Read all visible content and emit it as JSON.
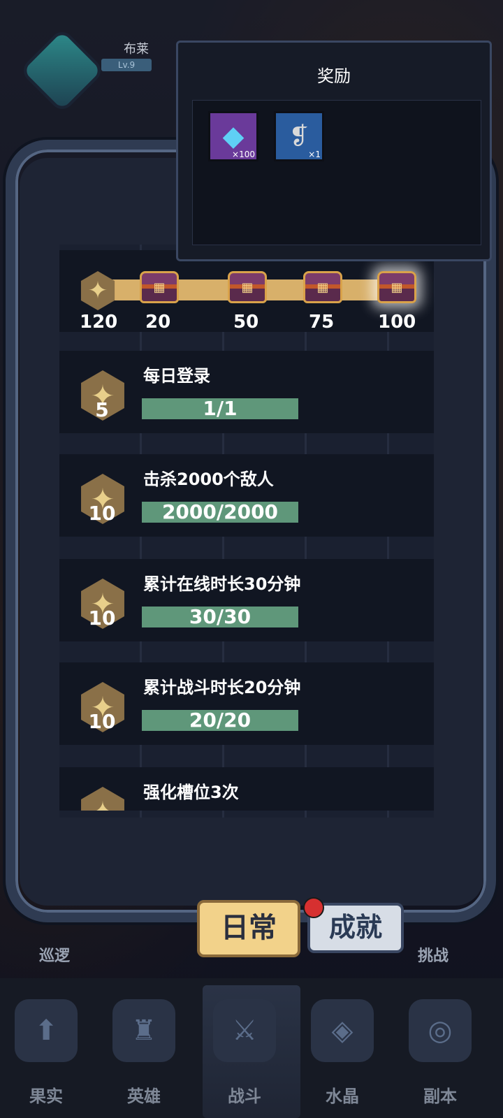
{
  "player": {
    "name": "布莱",
    "level": "Lv.9"
  },
  "panel": {
    "tab_title": "日常"
  },
  "reward_popup": {
    "title": "奖励",
    "items": [
      {
        "icon": "diamond-icon",
        "qty": "×100"
      },
      {
        "icon": "scroll-icon",
        "qty": "×1"
      }
    ]
  },
  "progress": {
    "current_points": "120",
    "milestones": [
      "20",
      "50",
      "75",
      "100"
    ]
  },
  "tasks": [
    {
      "name": "每日登录",
      "points": "5",
      "progress": "1/1"
    },
    {
      "name": "击杀2000个敌人",
      "points": "10",
      "progress": "2000/2000"
    },
    {
      "name": "累计在线时长30分钟",
      "points": "10",
      "progress": "30/30"
    },
    {
      "name": "累计战斗时长20分钟",
      "points": "10",
      "progress": "20/20"
    },
    {
      "name": "强化槽位3次"
    }
  ],
  "tabs": {
    "daily": "日常",
    "achievement": "成就"
  },
  "side": {
    "left": "巡逻",
    "right": "挑战"
  },
  "nav": {
    "items": [
      {
        "label": "果实",
        "icon": "fruit-icon"
      },
      {
        "label": "英雄",
        "icon": "hero-icon"
      },
      {
        "label": "战斗",
        "icon": "battle-icon"
      },
      {
        "label": "水晶",
        "icon": "crystal-icon"
      },
      {
        "label": "副本",
        "icon": "dungeon-icon"
      }
    ]
  }
}
